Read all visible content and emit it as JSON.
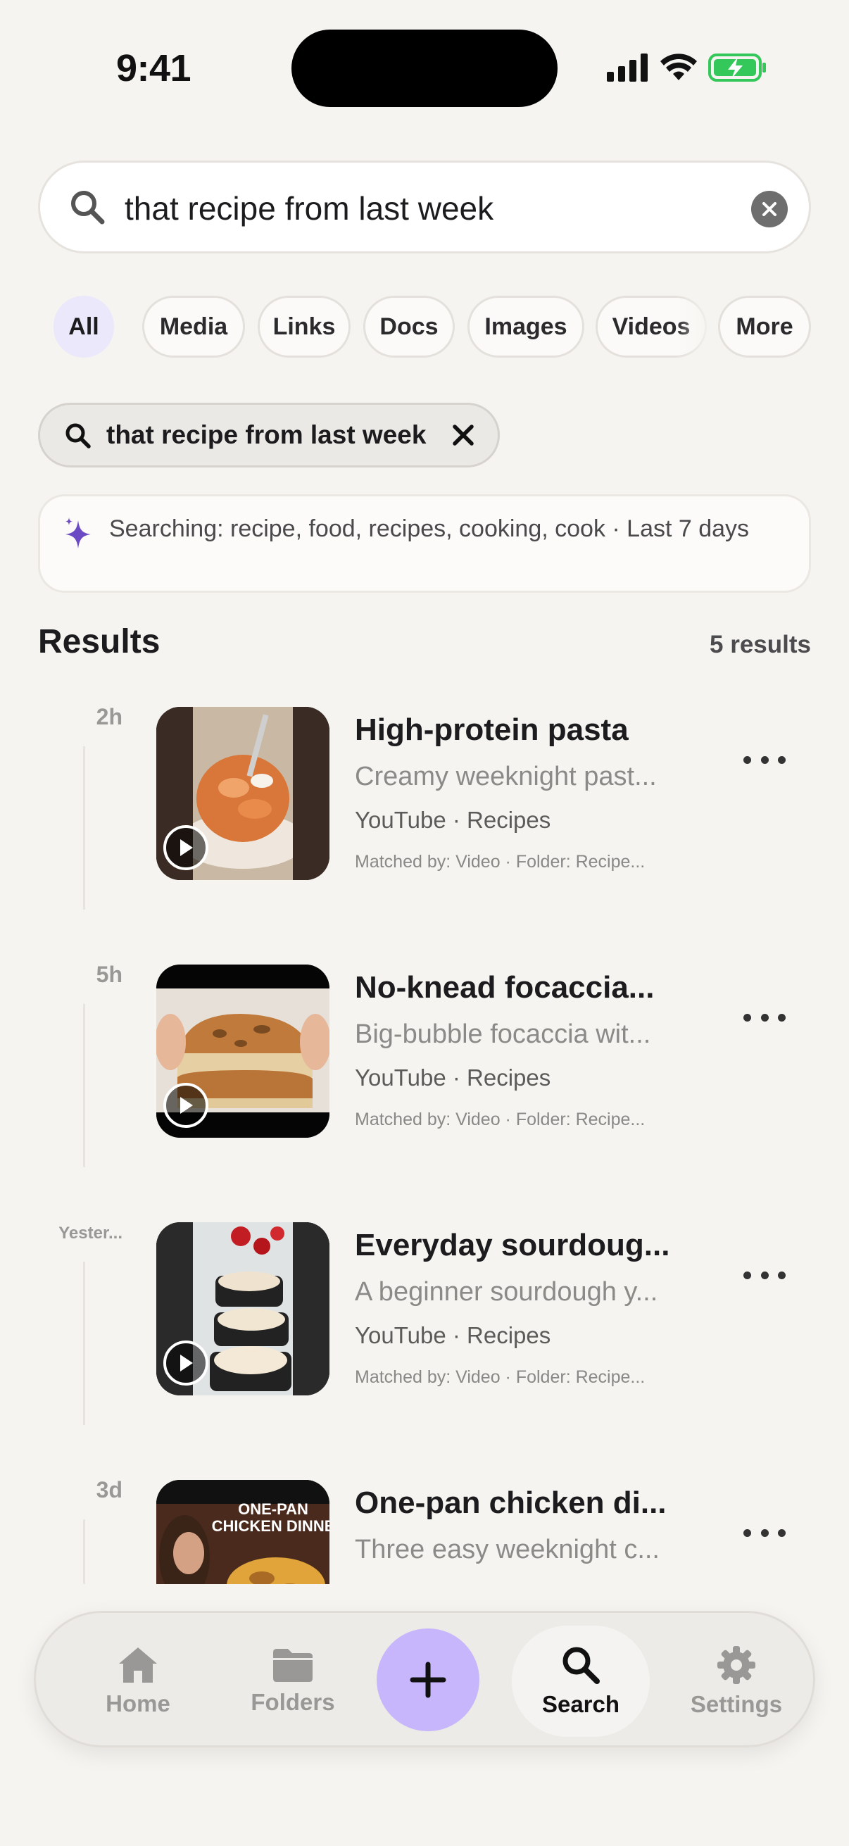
{
  "status_bar": {
    "time": "9:41"
  },
  "search": {
    "value": "that recipe from last week",
    "placeholder": ""
  },
  "filters": {
    "chips": [
      {
        "label": "All",
        "active": true
      },
      {
        "label": "Media",
        "active": false
      },
      {
        "label": "Links",
        "active": false
      },
      {
        "label": "Docs",
        "active": false
      },
      {
        "label": "Images",
        "active": false
      },
      {
        "label": "Videos",
        "active": false
      },
      {
        "label": "More",
        "active": false
      }
    ]
  },
  "query_pill": {
    "text": "that recipe from last week"
  },
  "info": {
    "text": "Searching: recipe, food, recipes, cooking, cook · Last 7 days"
  },
  "results_header": {
    "title": "Results",
    "count": "5 results"
  },
  "results": [
    {
      "time": "2h",
      "title": "High-protein pasta",
      "desc": "Creamy weeknight past...",
      "source": "YouTube · Recipes",
      "match": "Matched by: Video · Folder: Recipe..."
    },
    {
      "time": "5h",
      "title": "No-knead focaccia...",
      "desc": "Big-bubble focaccia wit...",
      "source": "YouTube · Recipes",
      "match": "Matched by: Video · Folder: Recipe..."
    },
    {
      "time": "Yester...",
      "title": "Everyday sourdoug...",
      "desc": "A beginner sourdough y...",
      "source": "YouTube · Recipes",
      "match": "Matched by: Video · Folder: Recipe..."
    },
    {
      "time": "3d",
      "title": "One-pan chicken di...",
      "desc": "Three easy weeknight c...",
      "source": "",
      "match": "",
      "thumb_text": "ONE-PAN CHICKEN DINNE"
    }
  ],
  "tab_bar": {
    "tabs": [
      {
        "label": "Home",
        "icon": "home-icon"
      },
      {
        "label": "Folders",
        "icon": "folder-icon"
      },
      {
        "label": "Search",
        "icon": "search-icon",
        "active": true
      },
      {
        "label": "Settings",
        "icon": "gear-icon"
      }
    ],
    "add_icon": "plus-icon"
  },
  "colors": {
    "background": "#f6f4f1",
    "accent_purple": "#c7b6fb",
    "active_chip": "#ece8fb",
    "battery_green": "#34c759"
  }
}
